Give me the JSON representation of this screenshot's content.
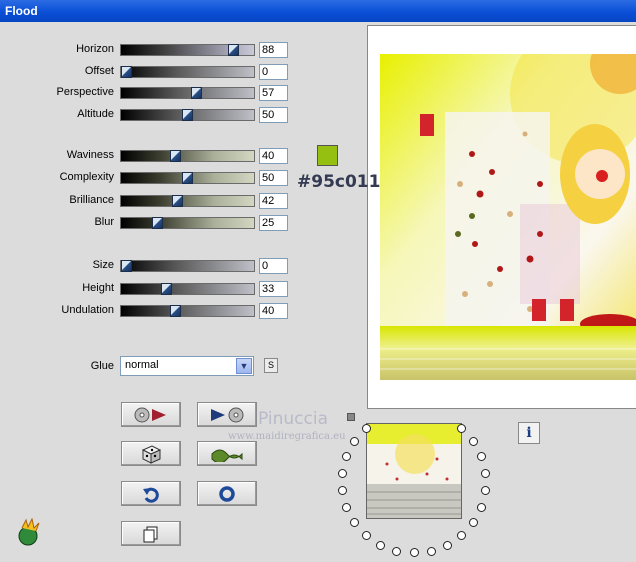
{
  "window": {
    "title": "Flood"
  },
  "groups": [
    {
      "sliders": [
        {
          "key": "horizon",
          "label": "Horizon",
          "value": "88",
          "fraction": 0.88,
          "style": "g-horizon"
        },
        {
          "key": "offset",
          "label": "Offset",
          "value": "0",
          "fraction": 0.0,
          "style": "g-grey"
        },
        {
          "key": "perspective",
          "label": "Perspective",
          "value": "57",
          "fraction": 0.57,
          "style": "g-grey"
        },
        {
          "key": "altitude",
          "label": "Altitude",
          "value": "50",
          "fraction": 0.5,
          "style": "g-grey"
        }
      ]
    },
    {
      "sliders": [
        {
          "key": "waviness",
          "label": "Waviness",
          "value": "40",
          "fraction": 0.4,
          "style": "g-olive"
        },
        {
          "key": "complexity",
          "label": "Complexity",
          "value": "50",
          "fraction": 0.5,
          "style": "g-olive"
        },
        {
          "key": "brilliance",
          "label": "Brilliance",
          "value": "42",
          "fraction": 0.42,
          "style": "g-olive"
        },
        {
          "key": "blur",
          "label": "Blur",
          "value": "25",
          "fraction": 0.25,
          "style": "g-olive"
        }
      ]
    },
    {
      "sliders": [
        {
          "key": "size",
          "label": "Size",
          "value": "0",
          "fraction": 0.0,
          "style": "g-grey"
        },
        {
          "key": "height",
          "label": "Height",
          "value": "33",
          "fraction": 0.33,
          "style": "g-grey"
        },
        {
          "key": "undulation",
          "label": "Undulation",
          "value": "40",
          "fraction": 0.4,
          "style": "g-grey"
        }
      ]
    }
  ],
  "color": {
    "hex_label": "#95c011",
    "swatch": "#95c011"
  },
  "glue": {
    "label": "Glue",
    "selected": "normal",
    "side_button": "S"
  },
  "buttons": [
    {
      "name": "load-preset-button",
      "icon": "disc-arrow-icon"
    },
    {
      "name": "save-preset-button",
      "icon": "arrow-disc-icon"
    },
    {
      "name": "random-button",
      "icon": "dice-icon"
    },
    {
      "name": "wave-button",
      "icon": "wave-icon"
    },
    {
      "name": "undo-button",
      "icon": "undo-arrow-icon"
    },
    {
      "name": "reset-button",
      "icon": "ring-icon"
    },
    {
      "name": "copy-button",
      "icon": "copy-pages-icon"
    }
  ],
  "watermark": {
    "name": "Pinuccia",
    "url": "www.maidiregrafica.eu"
  },
  "info_button": "i",
  "colors": {
    "titlebar": "#0a4fd6",
    "accent_green": "#95c011"
  }
}
